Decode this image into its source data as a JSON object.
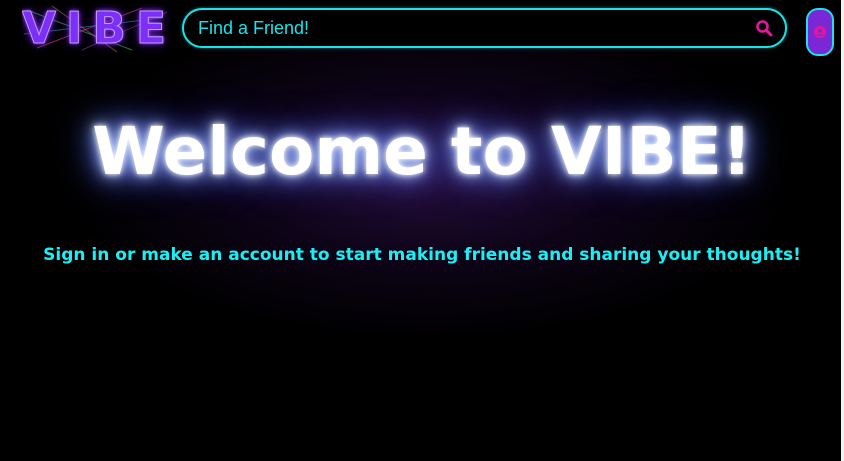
{
  "header": {
    "logo_text": "VIBE",
    "search": {
      "placeholder": "Find a Friend!",
      "value": ""
    },
    "search_icon": "search-icon",
    "profile_icon": "user-icon"
  },
  "hero": {
    "title": "Welcome to VIBE!",
    "subtitle": "Sign in or make an account to start making friends and sharing your thoughts!"
  },
  "colors": {
    "background": "#000000",
    "accent_cyan": "#19e3ea",
    "accent_purple": "#7a27d6",
    "accent_pink": "#e0199c",
    "title_glow": "#6f8fff"
  }
}
